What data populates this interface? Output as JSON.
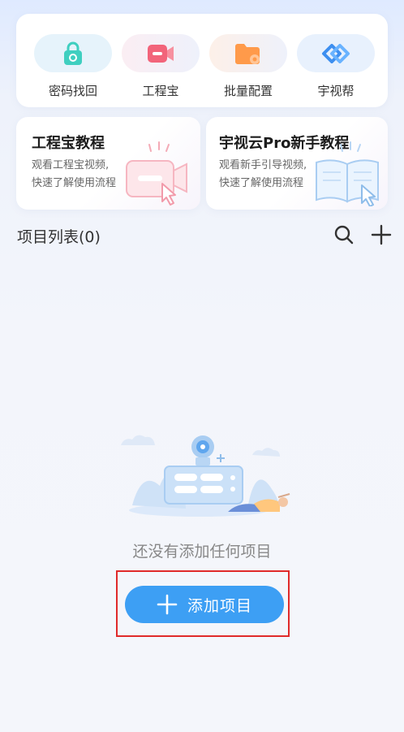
{
  "quick_actions": [
    {
      "label": "密码找回",
      "icon": "lock-icon",
      "color": "#3fcfc0"
    },
    {
      "label": "工程宝",
      "icon": "camera-icon",
      "color": "#f2647a"
    },
    {
      "label": "批量配置",
      "icon": "folder-gear-icon",
      "color": "#ff9a4a"
    },
    {
      "label": "宇视帮",
      "icon": "link-icon",
      "color": "#3d8ff0"
    }
  ],
  "tutorials": [
    {
      "title": "工程宝教程",
      "line1": "观看工程宝视频,",
      "line2": "快速了解使用流程"
    },
    {
      "title": "宇视云Pro新手教程",
      "line1": "观看新手引导视频,",
      "line2": "快速了解使用流程"
    }
  ],
  "projects": {
    "title": "项目列表(0)",
    "empty_text": "还没有添加任何项目",
    "add_label": "添加项目"
  },
  "colors": {
    "accent": "#3d9ff4",
    "highlight": "#e02a2a"
  }
}
